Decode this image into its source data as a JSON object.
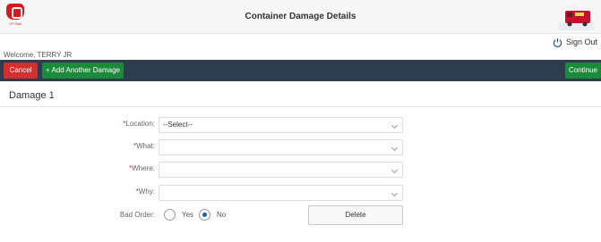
{
  "header": {
    "title": "Container Damage Details",
    "logo_text": "CP Rail",
    "logo_icon": "cp-logo-icon",
    "train_icon": "locomotive-icon",
    "signout_label": "Sign Out",
    "signout_icon": "power-icon"
  },
  "welcome": "Welcome, TERRY JR",
  "toolbar": {
    "cancel_label": "Cancel",
    "add_label": "+ Add Another Damage",
    "continue_label": "Continue"
  },
  "section": {
    "title": "Damage 1"
  },
  "form": {
    "required_mark": "*",
    "location_label": "Location:",
    "location_value": "--Select--",
    "what_label": "What:",
    "what_value": "",
    "where_label": "Where:",
    "where_value": "",
    "why_label": "Why:",
    "why_value": "",
    "bad_order_label": "Bad Order:",
    "yes_label": "Yes",
    "no_label": "No",
    "bad_order_selected": "No",
    "delete_label": "Delete"
  },
  "colors": {
    "toolbar": "#2e3d4d",
    "cancel": "#d32f2f",
    "add": "#1b8a3a",
    "continue": "#1b8a3a",
    "brand_red": "#d71920"
  }
}
